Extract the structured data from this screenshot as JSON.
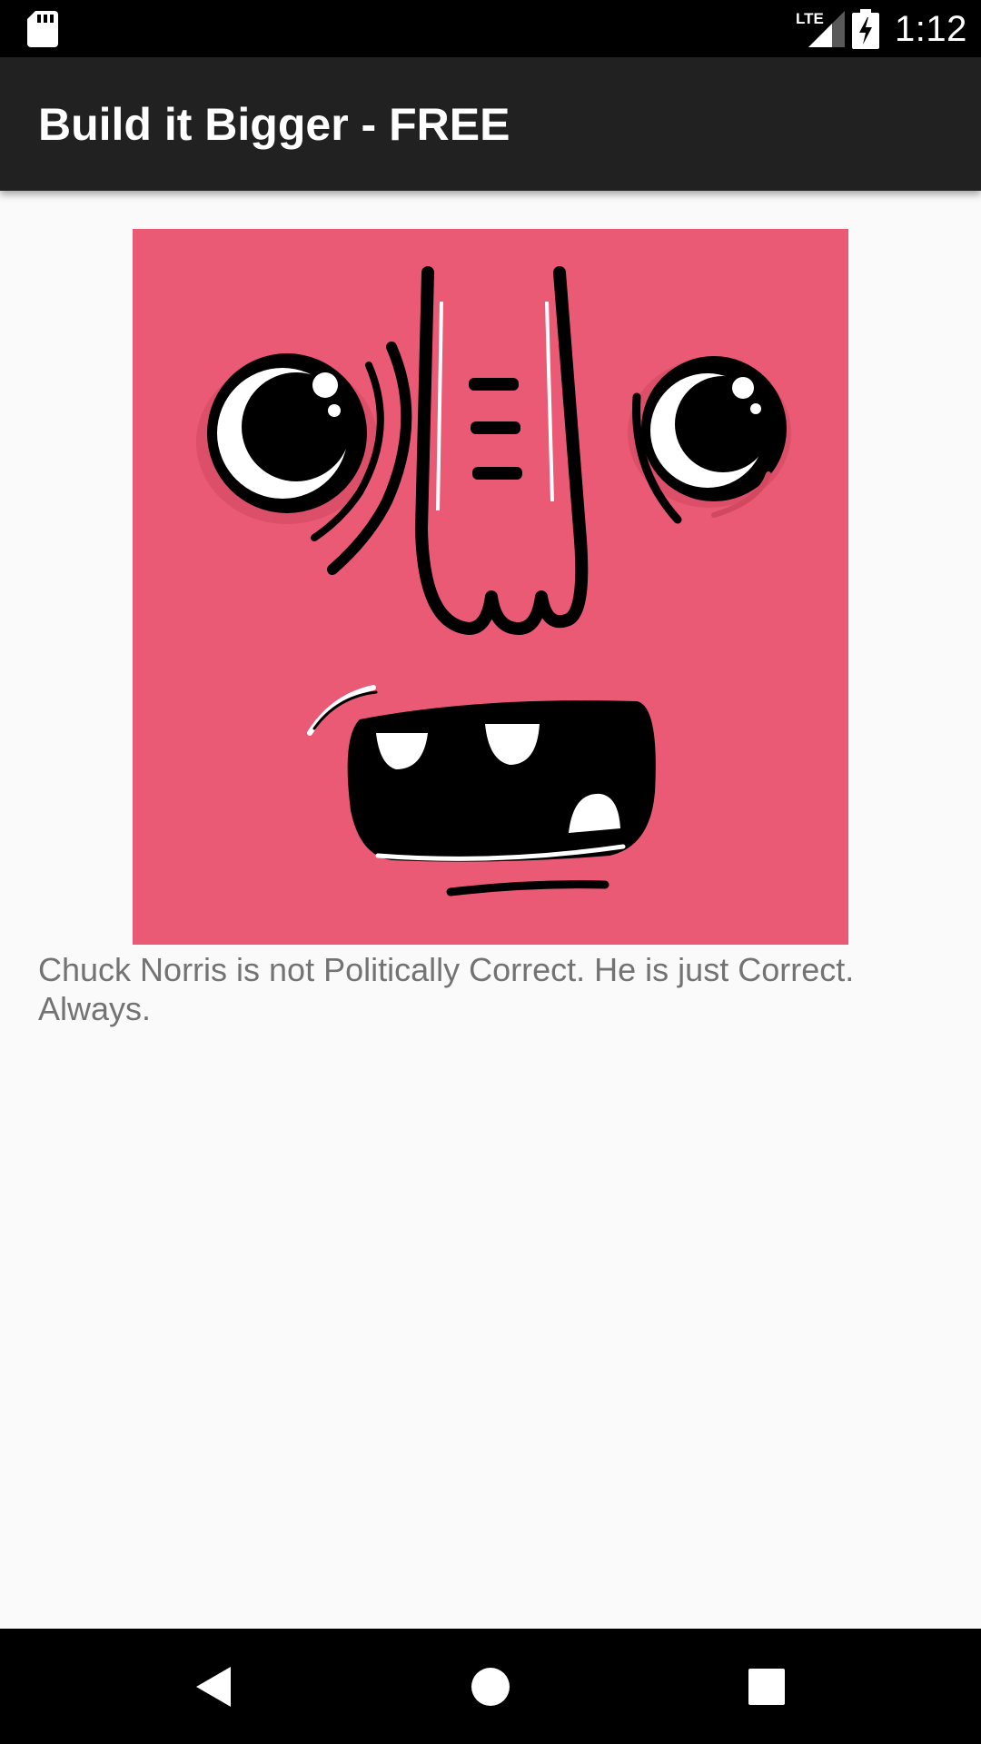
{
  "status_bar": {
    "time": "1:12",
    "network_label": "LTE",
    "icons": [
      "sd-card-icon",
      "lte-signal-icon",
      "battery-charging-icon"
    ]
  },
  "app_bar": {
    "title": "Build it Bigger - FREE"
  },
  "content": {
    "image_description_icon": "funny-face-illustration",
    "joke_text": "Chuck Norris is not Politically Correct. He is just Correct. Always."
  },
  "nav_bar": {
    "icons": [
      "back-icon",
      "home-icon",
      "recents-icon"
    ]
  },
  "colors": {
    "status_bar": "#000000",
    "app_bar": "#212121",
    "background": "#fafafa",
    "image_background": "#ea5a75",
    "joke_text": "#737373"
  }
}
